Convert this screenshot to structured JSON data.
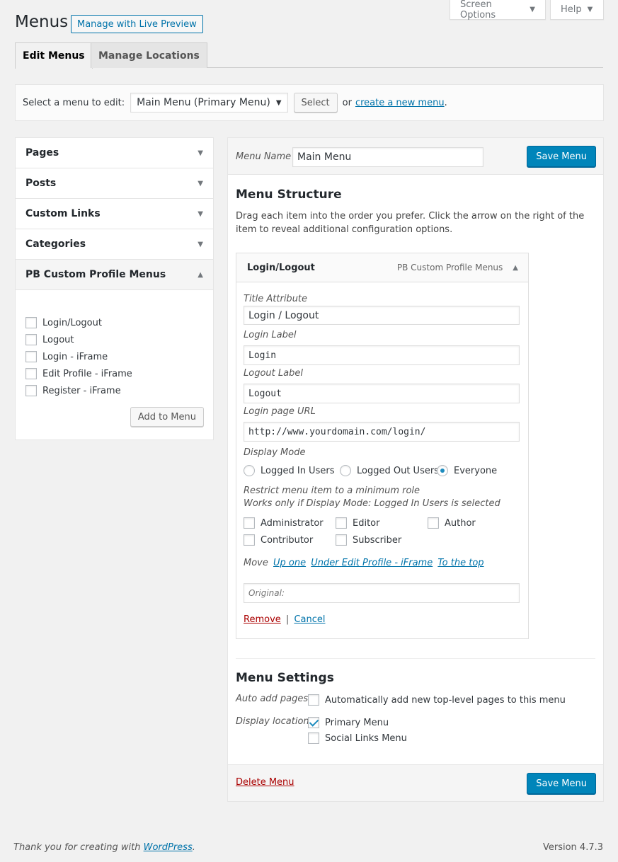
{
  "screen_meta": {
    "screen_options": "Screen Options",
    "help": "Help"
  },
  "header": {
    "title": "Menus",
    "live_preview": "Manage with Live Preview"
  },
  "tabs": [
    {
      "label": "Edit Menus",
      "active": true
    },
    {
      "label": "Manage Locations",
      "active": false
    }
  ],
  "select_bar": {
    "label": "Select a menu to edit:",
    "selected": "Main Menu (Primary Menu)",
    "select_button": "Select",
    "or_text": "or",
    "create_link": "create a new menu",
    "period": "."
  },
  "sidebar": {
    "sections": [
      "Pages",
      "Posts",
      "Custom Links",
      "Categories"
    ],
    "open_section": "PB Custom Profile Menus",
    "items": [
      "Login/Logout",
      "Logout",
      "Login - iFrame",
      "Edit Profile - iFrame",
      "Register - iFrame"
    ],
    "add_button": "Add to Menu"
  },
  "menu_edit": {
    "name_label": "Menu Name",
    "name_value": "Main Menu",
    "save_label": "Save Menu",
    "structure_title": "Menu Structure",
    "structure_desc": "Drag each item into the order you prefer. Click the arrow on the right of the item to reveal additional configuration options.",
    "item": {
      "title": "Login/Logout",
      "type": "PB Custom Profile Menus",
      "title_attr_label": "Title Attribute",
      "title_attr_value": "Login / Logout",
      "login_label_label": "Login Label",
      "login_label_value": "Login",
      "logout_label_label": "Logout Label",
      "logout_label_value": "Logout",
      "login_url_label": "Login page URL",
      "login_url_value": "http://www.yourdomain.com/login/",
      "display_mode_label": "Display Mode",
      "display_modes": [
        "Logged In Users",
        "Logged Out Users",
        "Everyone"
      ],
      "display_mode_selected": "Everyone",
      "restrict_line1": "Restrict menu item to a minimum role",
      "restrict_line2": "Works only if Display Mode: Logged In Users is selected",
      "roles": [
        "Administrator",
        "Editor",
        "Author",
        "Contributor",
        "Subscriber"
      ],
      "move_label": "Move",
      "move_links": [
        "Up one",
        "Under Edit Profile - iFrame",
        "To the top"
      ],
      "original_label": "Original:",
      "remove": "Remove",
      "separator": "|",
      "cancel": "Cancel"
    },
    "settings_title": "Menu Settings",
    "auto_add_label": "Auto add pages",
    "auto_add_text": "Automatically add new top-level pages to this menu",
    "display_location_label": "Display location",
    "locations": [
      {
        "label": "Primary Menu",
        "checked": true
      },
      {
        "label": "Social Links Menu",
        "checked": false
      }
    ],
    "delete_label": "Delete Menu"
  },
  "footer": {
    "thanks_text": "Thank you for creating with",
    "wp_link": "WordPress",
    "period": ".",
    "version": "Version 4.7.3"
  },
  "colors": {
    "primary": "#0085ba",
    "link": "#0073aa",
    "danger": "#a00",
    "background": "#f1f1f1"
  }
}
